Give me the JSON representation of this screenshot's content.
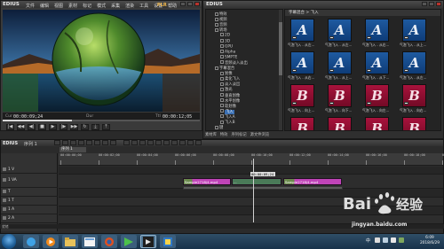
{
  "player": {
    "app_name": "EDIUS",
    "menu": [
      "文件",
      "编辑",
      "视图",
      "素材",
      "标记",
      "模式",
      "采集",
      "渲染",
      "工具",
      "设置",
      "帮助"
    ],
    "plr_label": "PLR",
    "cur_label": "Cur",
    "cur_tc": "00:00:09;24",
    "dur_label": "Dur",
    "ttl_label": "Ttl",
    "ttl_tc": "00:00:12;05",
    "progress": 0.35,
    "controls": [
      "|◀",
      "◀◀",
      "◀|",
      "■",
      "▶",
      "|▶",
      "▶▶",
      "↻",
      "⤓",
      "⤒"
    ]
  },
  "effects": {
    "title": "EDIUS",
    "tree": [
      {
        "label": "特效",
        "level": 1,
        "sel": false
      },
      {
        "label": "视频",
        "level": 1,
        "sel": false
      },
      {
        "label": "音频",
        "level": 1,
        "sel": false
      },
      {
        "label": "转场",
        "level": 1,
        "sel": false
      },
      {
        "label": "2D",
        "level": 2,
        "sel": false
      },
      {
        "label": "3D",
        "level": 2,
        "sel": false
      },
      {
        "label": "GPU",
        "level": 2,
        "sel": false
      },
      {
        "label": "Alpha",
        "level": 2,
        "sel": false
      },
      {
        "label": "SMPTE",
        "level": 2,
        "sel": false
      },
      {
        "label": "音频淡入淡出",
        "level": 2,
        "sel": false
      },
      {
        "label": "字幕混合",
        "level": 1,
        "sel": false
      },
      {
        "label": "划像",
        "level": 2,
        "sel": false
      },
      {
        "label": "柔化飞入",
        "level": 2,
        "sel": false
      },
      {
        "label": "淡入淡出",
        "level": 2,
        "sel": false
      },
      {
        "label": "激光",
        "level": 2,
        "sel": false
      },
      {
        "label": "垂直划像",
        "level": 2,
        "sel": false
      },
      {
        "label": "水平划像",
        "level": 2,
        "sel": false
      },
      {
        "label": "软划像",
        "level": 2,
        "sel": false
      },
      {
        "label": "飞入",
        "level": 2,
        "sel": true
      },
      {
        "label": "飞入A",
        "level": 2,
        "sel": false
      },
      {
        "label": "飞入B",
        "level": 2,
        "sel": false
      },
      {
        "label": "键",
        "level": 1,
        "sel": false
      }
    ],
    "gallery_title": "字幕混合 > 飞入",
    "tiles": [
      {
        "glyph": "A",
        "kind": "a",
        "caption": "气泡飞入 - 从左..."
      },
      {
        "glyph": "A",
        "kind": "a",
        "caption": "气泡飞入 - 从左..."
      },
      {
        "glyph": "A",
        "kind": "a",
        "caption": "气泡飞入 - 从右..."
      },
      {
        "glyph": "A",
        "kind": "a",
        "caption": "气泡飞入 - 从上..."
      },
      {
        "glyph": "A",
        "kind": "a",
        "caption": "气泡飞入 - 从右..."
      },
      {
        "glyph": "A",
        "kind": "a",
        "caption": "气泡飞入 - 从上..."
      },
      {
        "glyph": "A",
        "kind": "a",
        "caption": "气泡飞入 - 从下..."
      },
      {
        "glyph": "A",
        "kind": "a",
        "caption": "气泡飞入 - 从左..."
      },
      {
        "glyph": "B",
        "kind": "b",
        "caption": "气泡飞入 - 向上..."
      },
      {
        "glyph": "B",
        "kind": "b",
        "caption": "气泡飞入 - 向下..."
      },
      {
        "glyph": "B",
        "kind": "b",
        "caption": "气泡飞入 - 向左..."
      },
      {
        "glyph": "B",
        "kind": "b",
        "caption": "气泡飞入 - 向右..."
      },
      {
        "glyph": "B",
        "kind": "b",
        "caption": ""
      },
      {
        "glyph": "B",
        "kind": "b",
        "caption": ""
      },
      {
        "glyph": "B",
        "kind": "b",
        "caption": ""
      },
      {
        "glyph": "B",
        "kind": "b",
        "caption": ""
      }
    ],
    "tabs": [
      "素材库",
      "特效",
      "序列标记",
      "源文件浏览"
    ]
  },
  "timeline": {
    "app_name": "EDIUS",
    "sequence": "序列 1",
    "seq_tab": "序列 1",
    "ruler": [
      "00:00:00;00",
      "00:00:02;00",
      "00:00:04;00",
      "00:00:06;00",
      "00:00:08;00",
      "00:00:10;00",
      "00:00:12;00",
      "00:00:14;00",
      "00:00:16;00",
      "00:00:18;00",
      "00:00:20;00"
    ],
    "tracks": [
      {
        "label": "1 V",
        "h": 9
      },
      {
        "label": "1 VA",
        "h": 16
      },
      {
        "label": "T",
        "h": 10
      },
      {
        "label": "1 T",
        "h": 10
      },
      {
        "label": "1 A",
        "h": 10
      },
      {
        "label": "2 A",
        "h": 10
      }
    ],
    "clips": [
      {
        "label": "Sample2718/4.mp4",
        "cls": "thumb"
      },
      {
        "label": "...",
        "cls": "green"
      },
      {
        "label": "Sample2718/4.mp4",
        "cls": "thumb"
      }
    ],
    "playhead_tc": "00:00:09;24",
    "status": "就绪"
  },
  "taskbar": {
    "clock_time": "6:09",
    "clock_date": "2018/6/29",
    "ime": "中"
  },
  "watermark": {
    "brand": "Bai 经验",
    "url": "jingyan.baidu.com"
  }
}
